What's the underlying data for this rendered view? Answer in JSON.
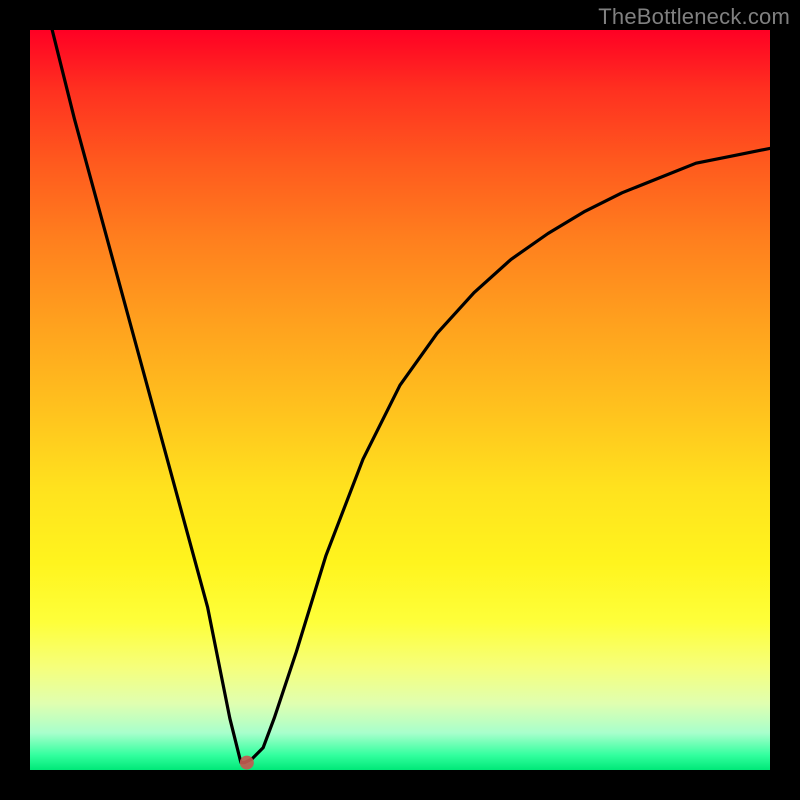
{
  "watermark": "TheBottleneck.com",
  "chart_data": {
    "type": "line",
    "title": "",
    "xlabel": "",
    "ylabel": "",
    "xlim": [
      0,
      100
    ],
    "ylim": [
      0,
      100
    ],
    "x": [
      3,
      6,
      9,
      12,
      15,
      18,
      21,
      24,
      26,
      27,
      28,
      28.5,
      29,
      30,
      31.5,
      33,
      36,
      40,
      45,
      50,
      55,
      60,
      65,
      70,
      75,
      80,
      85,
      90,
      95,
      100
    ],
    "values": [
      100,
      88,
      77,
      66,
      55,
      44,
      33,
      22,
      12,
      7,
      3,
      1,
      1,
      1.5,
      3,
      7,
      16,
      29,
      42,
      52,
      59,
      64.5,
      69,
      72.5,
      75.5,
      78,
      80,
      82,
      83,
      84
    ],
    "marker": {
      "x": 29.3,
      "y": 1
    },
    "grid": false,
    "legend": false
  },
  "colors": {
    "gradient_top": "#ff0024",
    "gradient_bottom": "#00e878",
    "curve": "#000000",
    "marker": "#c25a50",
    "watermark": "#808080",
    "frame": "#000000"
  }
}
